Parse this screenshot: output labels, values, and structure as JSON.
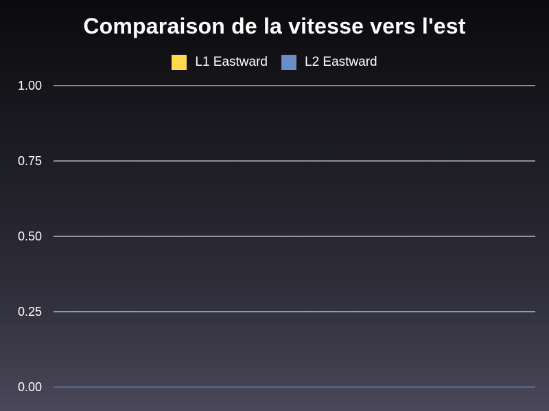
{
  "chart_data": {
    "type": "line",
    "title": "Comparaison de la vitesse vers l'est",
    "xlabel": "",
    "ylabel": "",
    "ylim": [
      0,
      1
    ],
    "y_ticks": [
      "0.00",
      "0.25",
      "0.50",
      "0.75",
      "1.00"
    ],
    "y_tick_values": [
      0,
      0.25,
      0.5,
      0.75,
      1
    ],
    "grid": true,
    "legend_position": "top",
    "categories": [],
    "series": [
      {
        "name": "L1 Eastward",
        "color": "#ffd84d",
        "values": []
      },
      {
        "name": "L2 Eastward",
        "color": "#6b8cc4",
        "values": []
      }
    ]
  }
}
